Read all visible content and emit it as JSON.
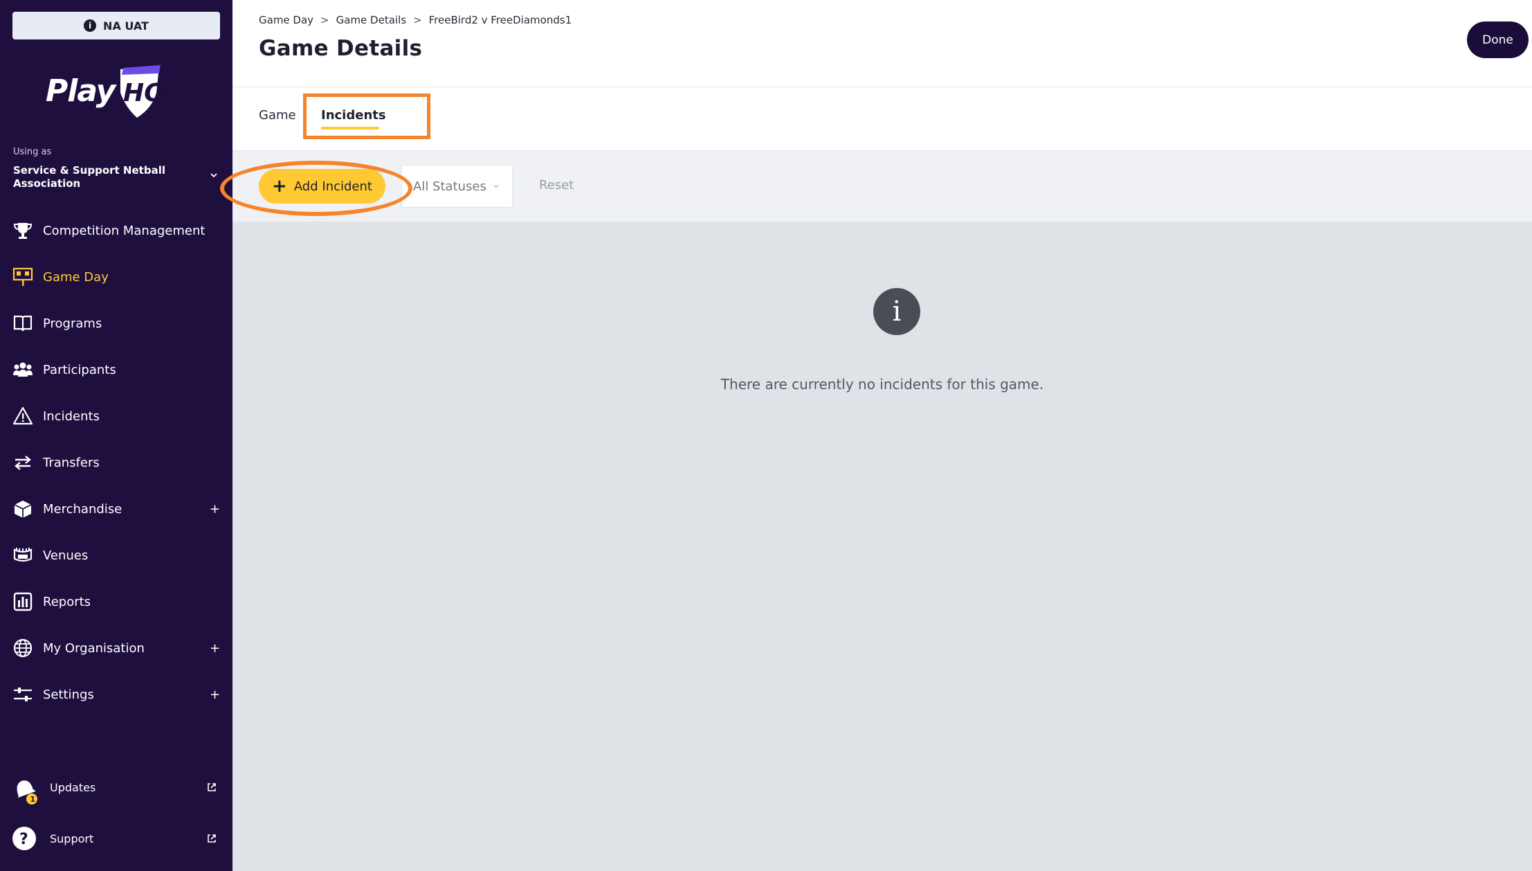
{
  "env": {
    "label": "NA UAT"
  },
  "logo": {
    "text": "Play",
    "mark": "HQ"
  },
  "org": {
    "using_as_label": "Using as",
    "name": "Service & Support Netball Association"
  },
  "nav": {
    "items": [
      {
        "label": "Competition Management",
        "icon": "trophy-icon",
        "has_plus": false
      },
      {
        "label": "Game Day",
        "icon": "scoreboard-icon",
        "active": true,
        "has_plus": false
      },
      {
        "label": "Programs",
        "icon": "book-icon",
        "has_plus": false
      },
      {
        "label": "Participants",
        "icon": "people-icon",
        "has_plus": false
      },
      {
        "label": "Incidents",
        "icon": "warning-icon",
        "has_plus": false
      },
      {
        "label": "Transfers",
        "icon": "transfer-arrows-icon",
        "has_plus": false
      },
      {
        "label": "Merchandise",
        "icon": "box-icon",
        "has_plus": true
      },
      {
        "label": "Venues",
        "icon": "stadium-icon",
        "has_plus": false
      },
      {
        "label": "Reports",
        "icon": "report-chart-icon",
        "has_plus": false
      },
      {
        "label": "My Organisation",
        "icon": "globe-icon",
        "has_plus": true
      },
      {
        "label": "Settings",
        "icon": "sliders-icon",
        "has_plus": true
      }
    ],
    "plus_symbol": "+"
  },
  "bottom": {
    "updates": {
      "label": "Updates",
      "badge": "1"
    },
    "support": {
      "label": "Support"
    }
  },
  "header": {
    "breadcrumb": [
      "Game Day",
      "Game Details",
      "FreeBird2 v FreeDiamonds1"
    ],
    "breadcrumb_sep": ">",
    "title": "Game Details",
    "done_label": "Done"
  },
  "tabs": {
    "game": "Game",
    "incidents": "Incidents",
    "active": "incidents"
  },
  "toolbar": {
    "add_label": "Add Incident",
    "status_value": "All Statuses",
    "reset_label": "Reset"
  },
  "empty": {
    "message": "There are currently no incidents for this game."
  },
  "colors": {
    "sidebar": "#1f0f3f",
    "accent": "#ffc933",
    "highlight": "#f5842a"
  }
}
